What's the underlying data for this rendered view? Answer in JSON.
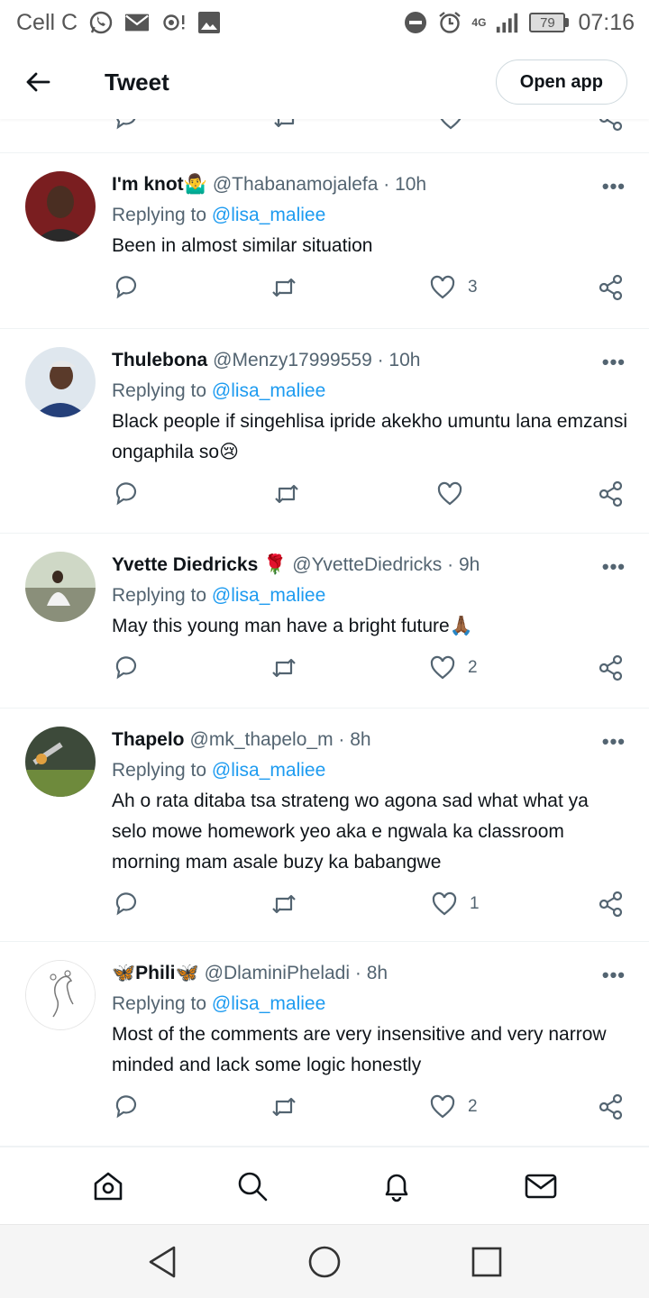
{
  "status_bar": {
    "carrier": "Cell C",
    "network": "4G",
    "battery": "79",
    "time": "07:16"
  },
  "header": {
    "title": "Tweet",
    "open_app_label": "Open app"
  },
  "tweets": [
    {
      "name": "I'm knot🤷‍♂️",
      "handle": "@Thabanamojalefa · 10h",
      "replying_prefix": "Replying to",
      "replying_to": "@lisa_maliee",
      "text": "Been in almost similar situation",
      "likes": "3"
    },
    {
      "name": "Thulebona",
      "handle": "@Menzy17999559 · 10h",
      "replying_prefix": "Replying to",
      "replying_to": "@lisa_maliee",
      "text": "Black people if singehlisa ipride akekho umuntu lana emzansi ongaphila so😢",
      "likes": ""
    },
    {
      "name": "Yvette Diedricks 🌹",
      "handle": "@YvetteDiedricks · 9h",
      "replying_prefix": "Replying to",
      "replying_to": "@lisa_maliee",
      "text": "May this young man have a bright future🙏🏾",
      "likes": "2"
    },
    {
      "name": "Thapelo",
      "handle": "@mk_thapelo_m · 8h",
      "replying_prefix": "Replying to",
      "replying_to": "@lisa_maliee",
      "text": "Ah o rata ditaba tsa strateng wo agona sad what what ya selo mowe homework yeo aka e ngwala ka classroom morning mam asale buzy ka babangwe",
      "likes": "1"
    },
    {
      "name": "🦋Phili🦋",
      "handle": "@DlaminiPheladi · 8h",
      "replying_prefix": "Replying to",
      "replying_to": "@lisa_maliee",
      "text": "Most of the comments are very insensitive and very narrow minded and lack some logic honestly",
      "likes": "2"
    }
  ],
  "icons": {
    "reply": "reply-icon",
    "retweet": "retweet-icon",
    "like": "heart-icon",
    "share": "share-icon",
    "more": "more-icon"
  },
  "colors": {
    "accent": "#1d9bf0",
    "secondary_text": "#536471",
    "primary_text": "#0f1419"
  }
}
